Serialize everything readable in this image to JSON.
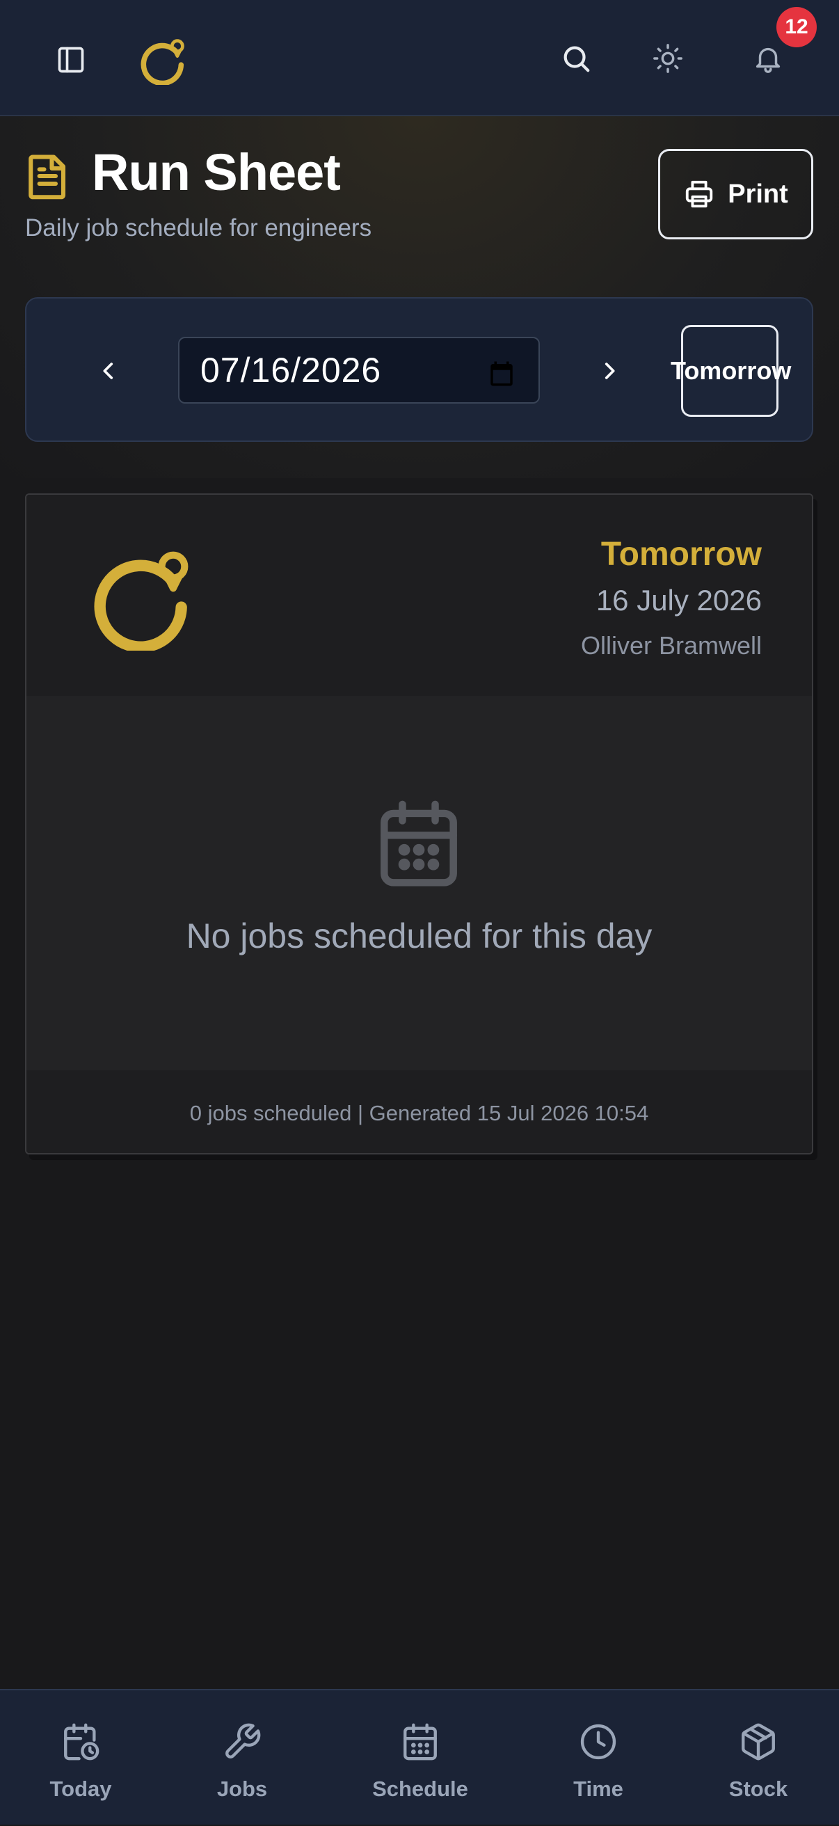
{
  "topbar": {
    "notification_count": "12"
  },
  "header": {
    "title": "Run Sheet",
    "subtitle": "Daily job schedule for engineers",
    "print_label": "Print"
  },
  "date_nav": {
    "date_value": "07/16/2026",
    "tomorrow_label": "Tomorrow"
  },
  "sheet": {
    "day_label": "Tomorrow",
    "date_text": "16 July 2026",
    "engineer": "Olliver Bramwell",
    "empty_message": "No jobs scheduled for this day",
    "footer": "0 jobs scheduled | Generated 15 Jul 2026 10:54"
  },
  "bottom_nav": {
    "items": [
      {
        "label": "Today",
        "icon": "calendar-clock-icon"
      },
      {
        "label": "Jobs",
        "icon": "wrench-icon"
      },
      {
        "label": "Schedule",
        "icon": "calendar-grid-icon"
      },
      {
        "label": "Time",
        "icon": "clock-icon"
      },
      {
        "label": "Stock",
        "icon": "box-icon"
      }
    ]
  },
  "colors": {
    "accent_gold": "#d4af3a",
    "topbar_bg": "#1b2336",
    "badge_red": "#e5343f",
    "page_bg": "#19191b"
  }
}
